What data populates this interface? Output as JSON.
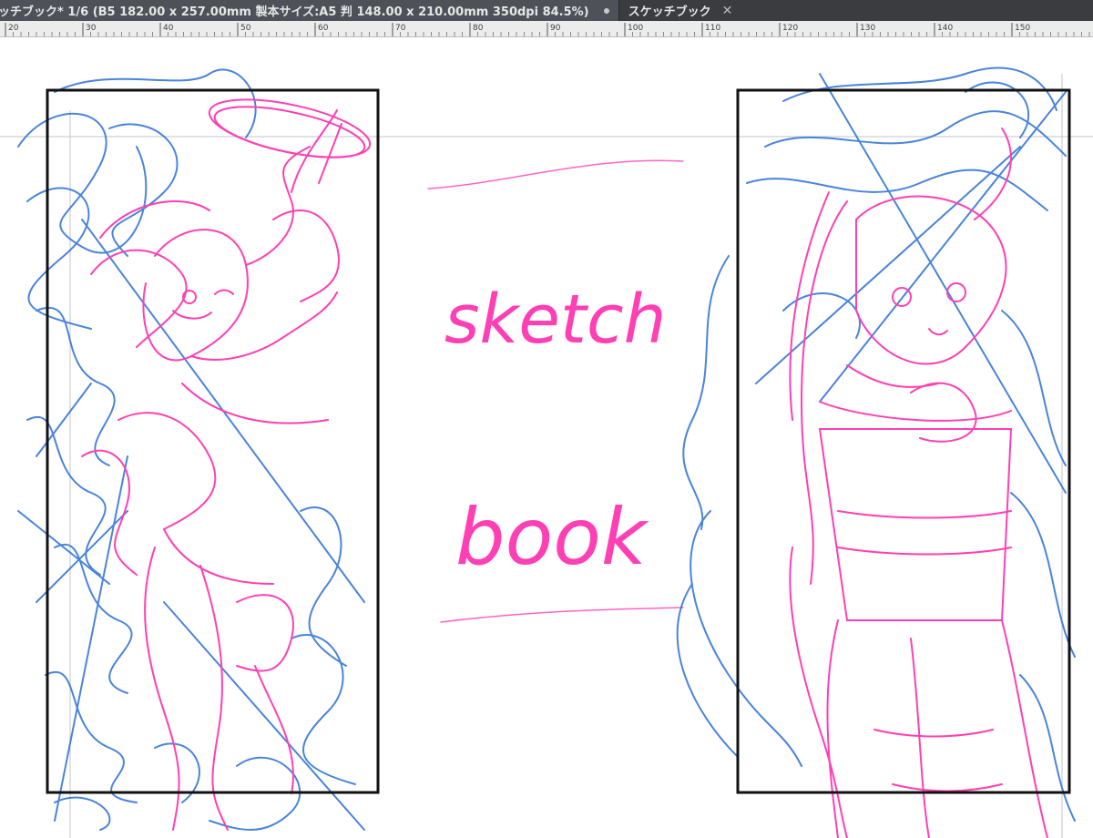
{
  "window": {
    "tabs": [
      {
        "label": "ッチブック* 1/6 (B5 182.00 x 257.00mm 製本サイズ:A5 判 148.00 x 210.00mm 350dpi 84.5%)",
        "modified": true,
        "active": true
      },
      {
        "label": "スケッチブック",
        "close_icon": "close-icon",
        "active": false
      }
    ]
  },
  "ruler": {
    "tick_labels": [
      "20",
      "30",
      "40",
      "50",
      "60",
      "70",
      "80",
      "90",
      "100",
      "110",
      "120",
      "130",
      "140",
      "150"
    ],
    "unit": "mm"
  },
  "canvas": {
    "title_text": {
      "line1": "sketch",
      "line2": "book"
    },
    "colors": {
      "pink": "#ff3fb4",
      "blue": "#2a6fd6",
      "frame": "#111111",
      "guide": "#c6c6cc"
    }
  }
}
